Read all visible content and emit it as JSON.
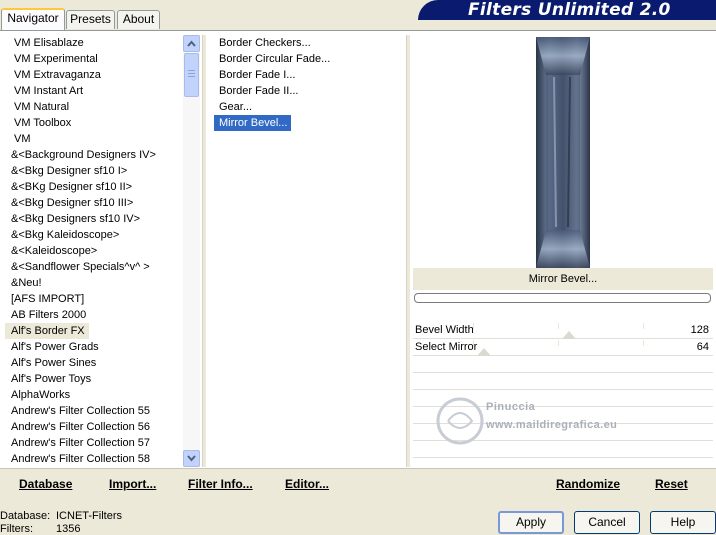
{
  "tabs": [
    "Navigator",
    "Presets",
    "About"
  ],
  "banner_title": "Filters Unlimited 2.0",
  "categories": [
    "VM Elisablaze",
    "VM Experimental",
    "VM Extravaganza",
    "VM Instant Art",
    "VM Natural",
    "VM Toolbox",
    "VM",
    "&<Background Designers IV>",
    "&<Bkg Designer sf10 I>",
    "&<BKg Designer sf10 II>",
    "&<Bkg Designer sf10 III>",
    "&<Bkg Designers sf10 IV>",
    "&<Bkg Kaleidoscope>",
    "&<Kaleidoscope>",
    "&<Sandflower Specials^v^ >",
    "&Neu!",
    "[AFS IMPORT]",
    "AB Filters 2000",
    "Alf's Border FX",
    "Alf's Power Grads",
    "Alf's Power Sines",
    "Alf's Power Toys",
    "AlphaWorks",
    "Andrew's Filter Collection 55",
    "Andrew's Filter Collection 56",
    "Andrew's Filter Collection 57",
    "Andrew's Filter Collection 58"
  ],
  "selected_category": "Alf's Border FX",
  "filters": [
    "Border Checkers...",
    "Border Circular Fade...",
    "Border Fade I...",
    "Border Fade II...",
    "Gear...",
    "Mirror Bevel..."
  ],
  "selected_filter": "Mirror Bevel...",
  "preview_caption": "Mirror Bevel...",
  "params": [
    {
      "label": "Bevel Width",
      "value": "128",
      "level": 0.5
    },
    {
      "label": "Select Mirror",
      "value": "64",
      "level": 0.0
    }
  ],
  "watermark": {
    "name": "Pinuccia",
    "url": "www.maildiregrafica.eu"
  },
  "links": {
    "database": "Database",
    "import": "Import...",
    "filter_info": "Filter Info...",
    "editor": "Editor...",
    "randomize": "Randomize",
    "reset": "Reset"
  },
  "status": {
    "database_label": "Database:",
    "database_value": "ICNET-Filters",
    "filters_label": "Filters:",
    "filters_value": "1356"
  },
  "buttons": {
    "apply": "Apply",
    "cancel": "Cancel",
    "help": "Help"
  }
}
